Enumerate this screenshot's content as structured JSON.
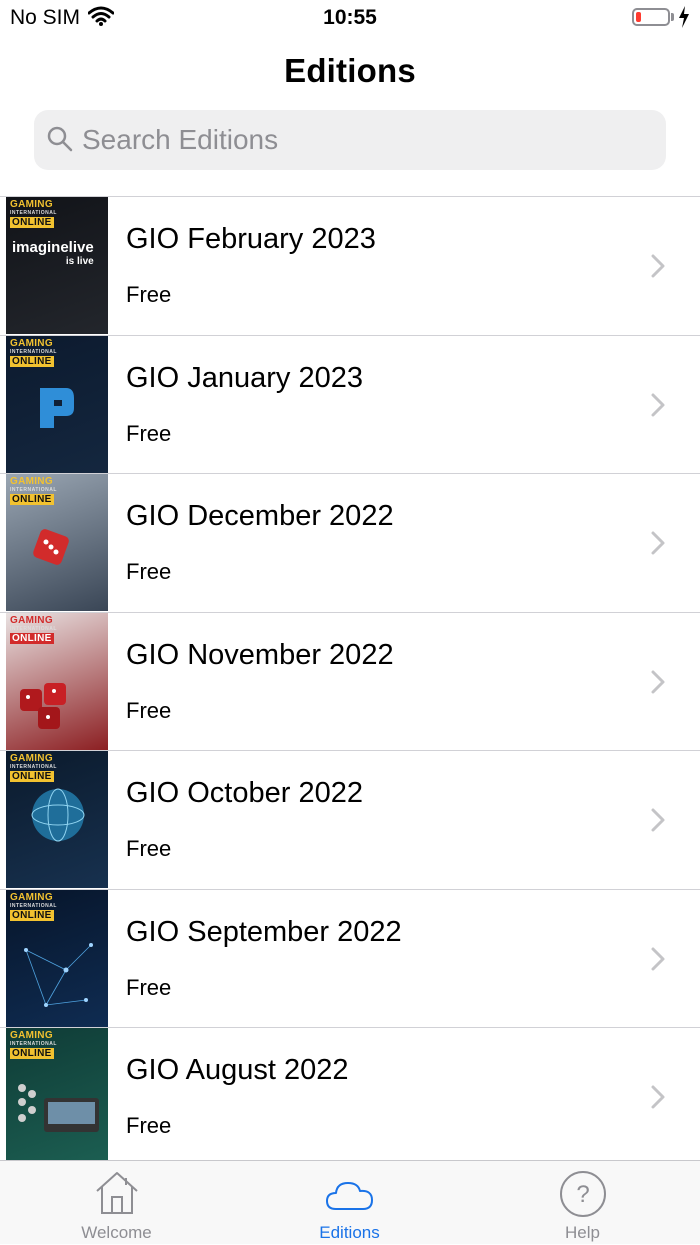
{
  "status": {
    "carrier": "No SIM",
    "time": "10:55",
    "battery_level": 0.15,
    "battery_color": "#ff3b30"
  },
  "nav": {
    "title": "Editions"
  },
  "search": {
    "placeholder": "Search Editions",
    "value": ""
  },
  "editions": [
    {
      "title": "GIO February 2023",
      "price": "Free",
      "cover_colors": [
        "#111318",
        "#23262c"
      ]
    },
    {
      "title": "GIO January 2023",
      "price": "Free",
      "cover_colors": [
        "#0c1a2e",
        "#14273f"
      ]
    },
    {
      "title": "GIO December 2022",
      "price": "Free",
      "cover_colors": [
        "#9aa6b3",
        "#3a4656"
      ]
    },
    {
      "title": "GIO November 2022",
      "price": "Free",
      "cover_colors": [
        "#e9e2e2",
        "#8c1f22"
      ]
    },
    {
      "title": "GIO October 2022",
      "price": "Free",
      "cover_colors": [
        "#0b1a2c",
        "#17314f"
      ]
    },
    {
      "title": "GIO September 2022",
      "price": "Free",
      "cover_colors": [
        "#07152a",
        "#0f2c52"
      ]
    },
    {
      "title": "GIO August 2022",
      "price": "Free",
      "cover_colors": [
        "#0f3b36",
        "#1c5f52"
      ]
    }
  ],
  "cover_text": {
    "brand_top": "GAMING",
    "brand_sub": "INTERNATIONAL",
    "brand_bottom": "ONLINE",
    "feb_headline": "imaginelive",
    "feb_subline": "is live"
  },
  "tabs": [
    {
      "label": "Welcome",
      "icon": "house-icon",
      "active": false
    },
    {
      "label": "Editions",
      "icon": "cloud-icon",
      "active": true
    },
    {
      "label": "Help",
      "icon": "question-circle-icon",
      "active": false
    }
  ],
  "colors": {
    "accent": "#1a73e8",
    "inactive": "#8e8e93",
    "separator": "#d1d1d6"
  }
}
